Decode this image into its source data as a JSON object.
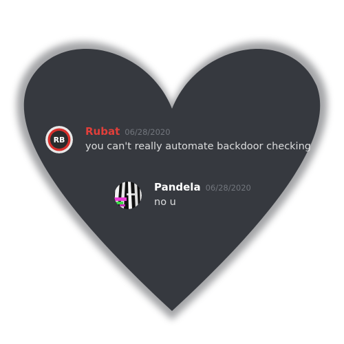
{
  "colors": {
    "heart_fill": "#36393f",
    "username_rubat": "#e23f3a",
    "username_pandela": "#ffffff",
    "timestamp": "#72767d",
    "message_text": "#dcddde"
  },
  "messages": [
    {
      "username": "Rubat",
      "timestamp": "06/28/2020",
      "text": "you can't really automate backdoor checking",
      "avatar_icon": "rb-logo-avatar",
      "avatar_text": "RB"
    },
    {
      "username": "Pandela",
      "timestamp": "06/28/2020",
      "text": "no u",
      "avatar_icon": "glitch-art-avatar"
    }
  ]
}
